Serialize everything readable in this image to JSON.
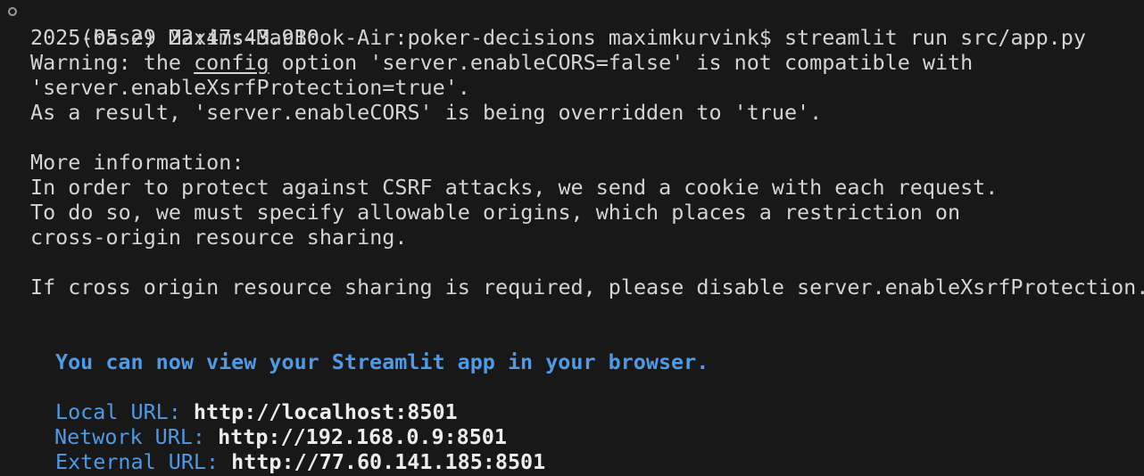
{
  "prompt": {
    "text": "(base) Maxims-MacBook-Air:poker-decisions maximkurvink$ streamlit run src/app.py"
  },
  "log": {
    "timestamp": "2025-05-29 22:47:43.910",
    "warning_prefix": "Warning: the ",
    "warning_link": "config",
    "warning_suffix": " option 'server.enableCORS=false' is not compatible with",
    "warning_line2": "'server.enableXsrfProtection=true'.",
    "warning_line3": "As a result, 'server.enableCORS' is being overridden to 'true'.",
    "more_info": "More information:",
    "info_line1": "In order to protect against CSRF attacks, we send a cookie with each request.",
    "info_line2": "To do so, we must specify allowable origins, which places a restriction on",
    "info_line3": "cross-origin resource sharing.",
    "info_line4": "If cross origin resource sharing is required, please disable server.enableXsrfProtection."
  },
  "streamlit": {
    "banner": "You can now view your Streamlit app in your browser.",
    "local_label": "Local URL: ",
    "local_url": "http://localhost:8501",
    "network_label": "Network URL: ",
    "network_url": "http://192.168.0.9:8501",
    "external_label": "External URL: ",
    "external_url": "http://77.60.141.185:8501"
  },
  "colors": {
    "background": "#181818",
    "text": "#d4d4d4",
    "accent_blue": "#4e9ae6"
  }
}
